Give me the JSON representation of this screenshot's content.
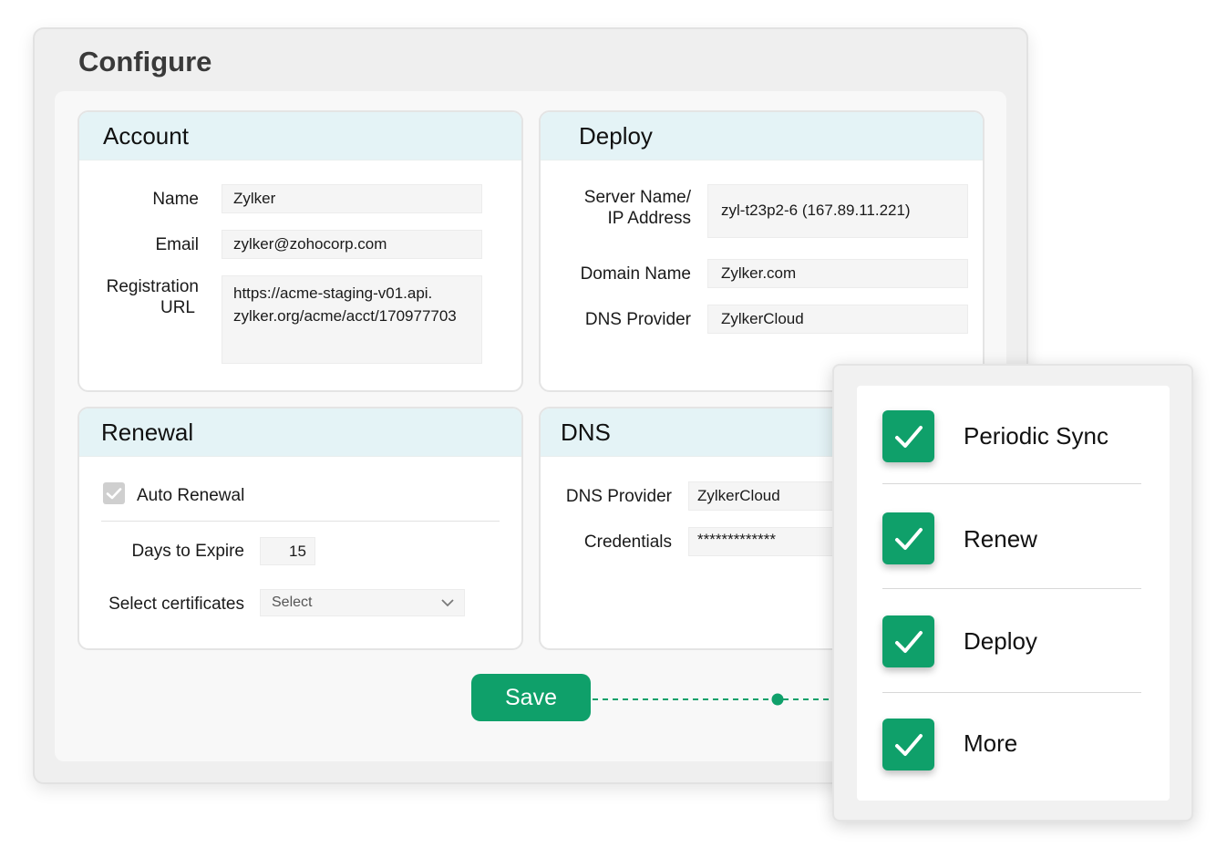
{
  "page": {
    "title": "Configure"
  },
  "account": {
    "title": "Account",
    "name_label": "Name",
    "name_value": "Zylker",
    "email_label": "Email",
    "email_value": "zylker@zohocorp.com",
    "url_label_1": "Registration",
    "url_label_2": "URL",
    "url_value_1": "https://acme-staging-v01.api.",
    "url_value_2": "zylker.org/acme/acct/170977703"
  },
  "deploy": {
    "title": "Deploy",
    "server_label_1": "Server Name/",
    "server_label_2": "IP Address",
    "server_value": "zyl-t23p2-6 (167.89.11.221)",
    "domain_label": "Domain Name",
    "domain_value": "Zylker.com",
    "dns_provider_label": "DNS Provider",
    "dns_provider_value": "ZylkerCloud"
  },
  "renewal": {
    "title": "Renewal",
    "auto_renewal_label": "Auto Renewal",
    "auto_renewal_checked": true,
    "days_label": "Days to Expire",
    "days_value": "15",
    "certs_label": "Select certificates",
    "certs_placeholder": "Select"
  },
  "dns": {
    "title": "DNS",
    "provider_label": "DNS Provider",
    "provider_value": "ZylkerCloud",
    "credentials_label": "Credentials",
    "credentials_value": "*************"
  },
  "actions": {
    "save_label": "Save"
  },
  "options": {
    "items": [
      {
        "label": "Periodic Sync",
        "checked": true
      },
      {
        "label": "Renew",
        "checked": true
      },
      {
        "label": "Deploy",
        "checked": true
      },
      {
        "label": "More",
        "checked": true
      }
    ]
  },
  "colors": {
    "accent": "#0fa06a",
    "panel_header": "#e4f3f6"
  }
}
